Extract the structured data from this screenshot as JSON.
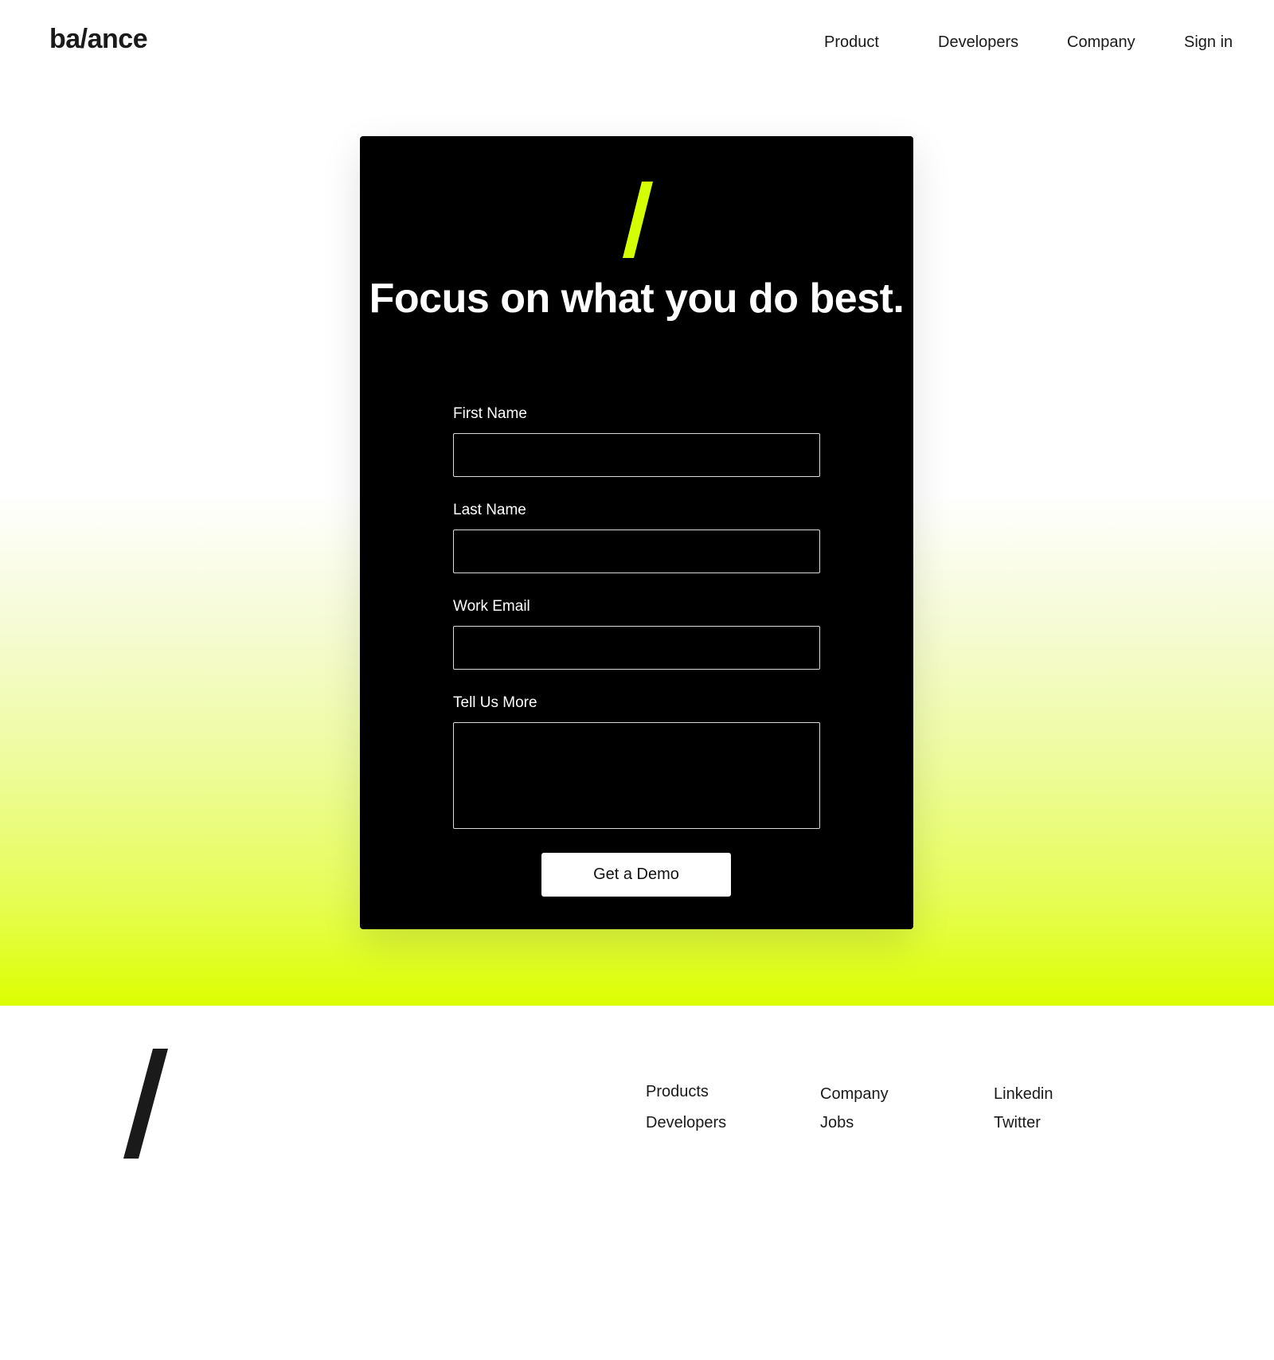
{
  "header": {
    "logo_text": "ba/ance",
    "nav": {
      "product": "Product",
      "developers": "Developers",
      "company": "Company",
      "sign_in": "Sign in"
    }
  },
  "card": {
    "slash_color": "#d4ff00",
    "title": "Focus on what you do best.",
    "fields": {
      "first_name": {
        "label": "First Name",
        "value": ""
      },
      "last_name": {
        "label": "Last Name",
        "value": ""
      },
      "work_email": {
        "label": "Work Email",
        "value": ""
      },
      "tell_us_more": {
        "label": "Tell Us More",
        "value": ""
      }
    },
    "submit_label": "Get a Demo"
  },
  "colors": {
    "accent": "#dcff00",
    "card_background": "#000000",
    "footer_slash": "#1a1a1a"
  },
  "footer": {
    "columns": [
      {
        "links": [
          "Products",
          "Developers"
        ]
      },
      {
        "links": [
          "Company",
          "Jobs"
        ]
      },
      {
        "links": [
          "Linkedin",
          "Twitter"
        ]
      }
    ]
  }
}
